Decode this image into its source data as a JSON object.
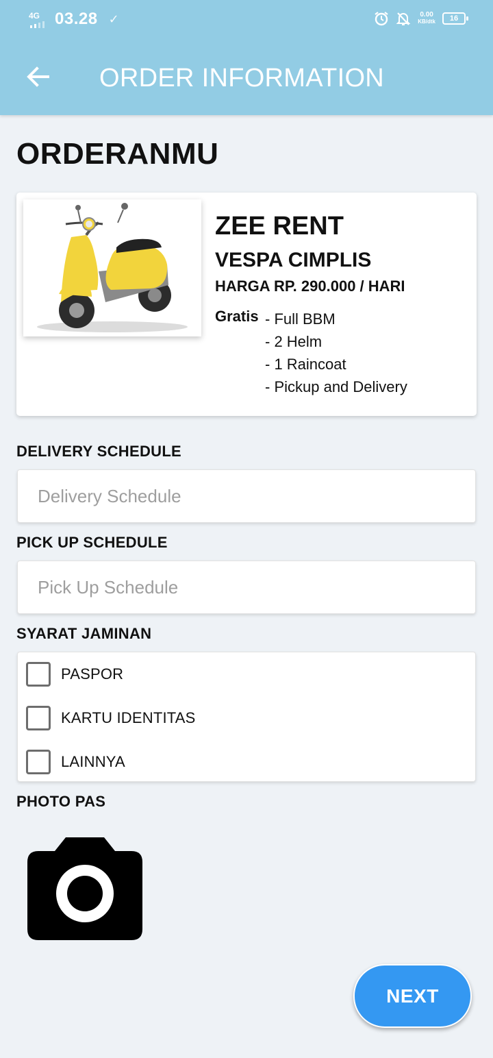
{
  "status_bar": {
    "network": "4G",
    "time": "03.28",
    "speed_value": "0.00",
    "speed_unit": "KB/dtk",
    "battery": "16",
    "icons": [
      "check-icon",
      "alarm-icon",
      "notifications-off-icon",
      "battery-icon"
    ]
  },
  "app_bar": {
    "title": "ORDER INFORMATION",
    "back_icon": "arrow-left-icon",
    "background": "#92cce4"
  },
  "page": {
    "heading": "ORDERANMU"
  },
  "order_card": {
    "shop_name": "ZEE RENT",
    "model": "VESPA CIMPLIS",
    "price": "HARGA RP. 290.000 / HARI",
    "gratis_label": "Gratis",
    "perks": [
      "- Full BBM",
      "- 2 Helm",
      "- 1 Raincoat",
      "- Pickup and Delivery"
    ],
    "image": "yellow-vespa-scooter-image"
  },
  "delivery": {
    "label": "DELIVERY SCHEDULE",
    "placeholder": "Delivery Schedule",
    "value": ""
  },
  "pickup": {
    "label": "PICK UP SCHEDULE",
    "placeholder": "Pick Up Schedule",
    "value": ""
  },
  "jaminan": {
    "label": "SYARAT JAMINAN",
    "options": [
      {
        "label": "PASPOR",
        "checked": false
      },
      {
        "label": "KARTU IDENTITAS",
        "checked": false
      },
      {
        "label": "LAINNYA",
        "checked": false
      }
    ]
  },
  "photo": {
    "label": "PHOTO PAS",
    "icon": "camera-icon"
  },
  "next_button": {
    "label": "NEXT",
    "color": "#3498f2"
  }
}
